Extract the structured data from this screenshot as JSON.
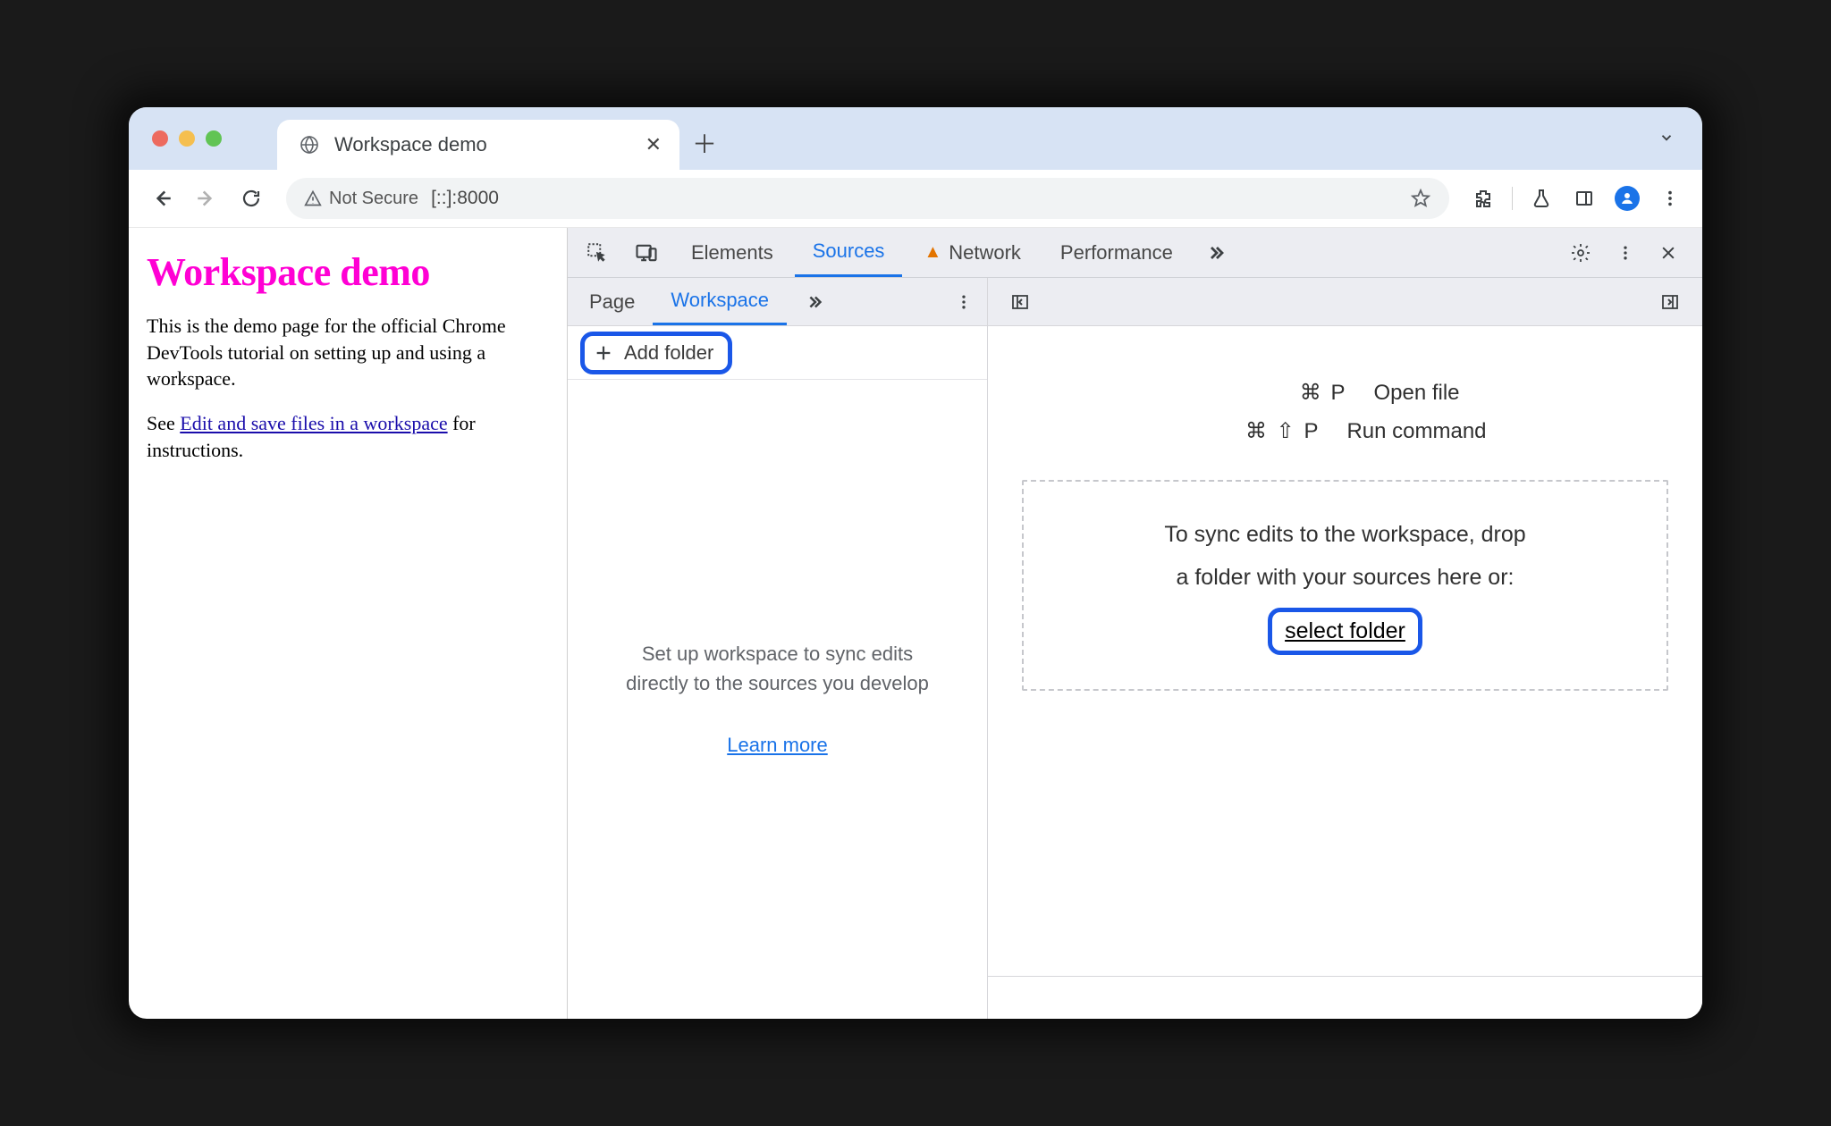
{
  "browser": {
    "tab_title": "Workspace demo",
    "url_security": "Not Secure",
    "url": "[::]:8000"
  },
  "page": {
    "heading": "Workspace demo",
    "p1": "This is the demo page for the official Chrome DevTools tutorial on setting up and using a workspace.",
    "p2a": "See ",
    "link": "Edit and save files in a workspace",
    "p2b": " for instructions."
  },
  "devtools": {
    "tabs": {
      "elements": "Elements",
      "sources": "Sources",
      "network": "Network",
      "performance": "Performance"
    },
    "subtabs": {
      "page": "Page",
      "workspace": "Workspace"
    },
    "add_folder": "Add folder",
    "workspace_hint": "Set up workspace to sync edits directly to the sources you develop",
    "learn_more": "Learn more",
    "shortcuts": {
      "open_file_keys": "⌘  P",
      "open_file_label": "Open file",
      "run_cmd_keys": "⌘ ⇧ P",
      "run_cmd_label": "Run command"
    },
    "dropzone": {
      "line1": "To sync edits to the workspace, drop",
      "line2": "a folder with your sources here or:",
      "select_folder": "select folder"
    }
  }
}
